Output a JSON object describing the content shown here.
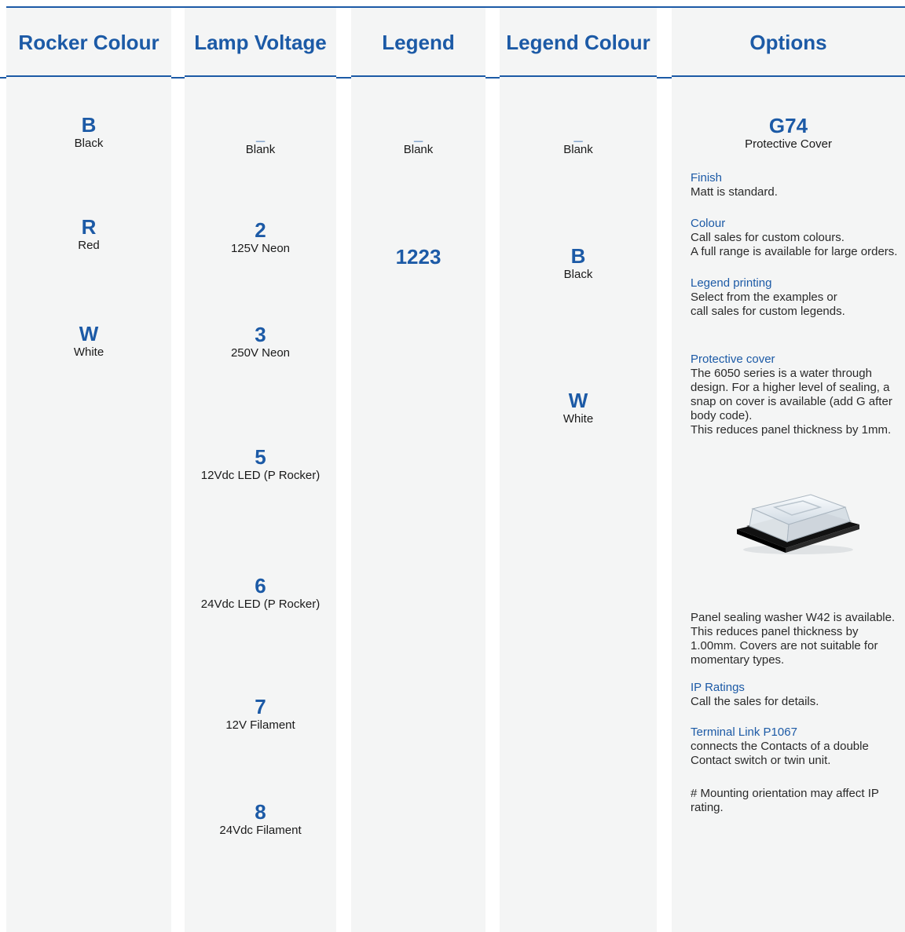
{
  "columns": {
    "rocker_colour": {
      "title": "Rocker Colour",
      "items": [
        {
          "code": "B",
          "desc": "Black"
        },
        {
          "code": "R",
          "desc": "Red"
        },
        {
          "code": "W",
          "desc": "White"
        }
      ]
    },
    "lamp_voltage": {
      "title": "Lamp Voltage",
      "items": [
        {
          "code": "_",
          "desc": "Blank"
        },
        {
          "code": "2",
          "desc": "125V Neon"
        },
        {
          "code": "3",
          "desc": "250V Neon"
        },
        {
          "code": "5",
          "desc": "12Vdc LED (P Rocker)"
        },
        {
          "code": "6",
          "desc": "24Vdc LED (P Rocker)"
        },
        {
          "code": "7",
          "desc": "12V Filament"
        },
        {
          "code": "8",
          "desc": "24Vdc Filament"
        }
      ]
    },
    "legend": {
      "title": "Legend",
      "items": [
        {
          "code": "_",
          "desc": "Blank"
        },
        {
          "code": "1223",
          "desc": ""
        }
      ]
    },
    "legend_colour": {
      "title": "Legend Colour",
      "items": [
        {
          "code": "_",
          "desc": "Blank"
        },
        {
          "code": "B",
          "desc": "Black"
        },
        {
          "code": "W",
          "desc": "White"
        }
      ]
    },
    "options": {
      "title": "Options",
      "main_code": "G74",
      "main_desc": "Protective Cover",
      "blocks": [
        {
          "label": "Finish",
          "text": "Matt is standard."
        },
        {
          "label": "Colour",
          "text": "Call sales for custom colours.\nA full range is available for large orders."
        },
        {
          "label": "Legend printing",
          "text": "Select from the examples or\ncall sales for custom legends."
        },
        {
          "label": "Protective cover",
          "text": "The 6050 series is a water through\ndesign. For a higher level of sealing, a\nsnap on cover is available (add G after\nbody code).\nThis reduces panel thickness by 1mm."
        },
        {
          "label": "",
          "text": "Panel sealing washer W42 is available.\nThis reduces panel thickness by\n1.00mm. Covers are not suitable for\nmomentary types."
        },
        {
          "label": "IP Ratings",
          "text": "Call the sales for details."
        },
        {
          "label": "Terminal Link P1067",
          "text": "connects the Contacts of a double\nContact switch or twin unit."
        },
        {
          "label": "",
          "text": "# Mounting orientation may affect IP\nrating."
        }
      ]
    }
  },
  "colors": {
    "accent": "#1c5aa6",
    "column_bg": "#f4f5f5"
  }
}
